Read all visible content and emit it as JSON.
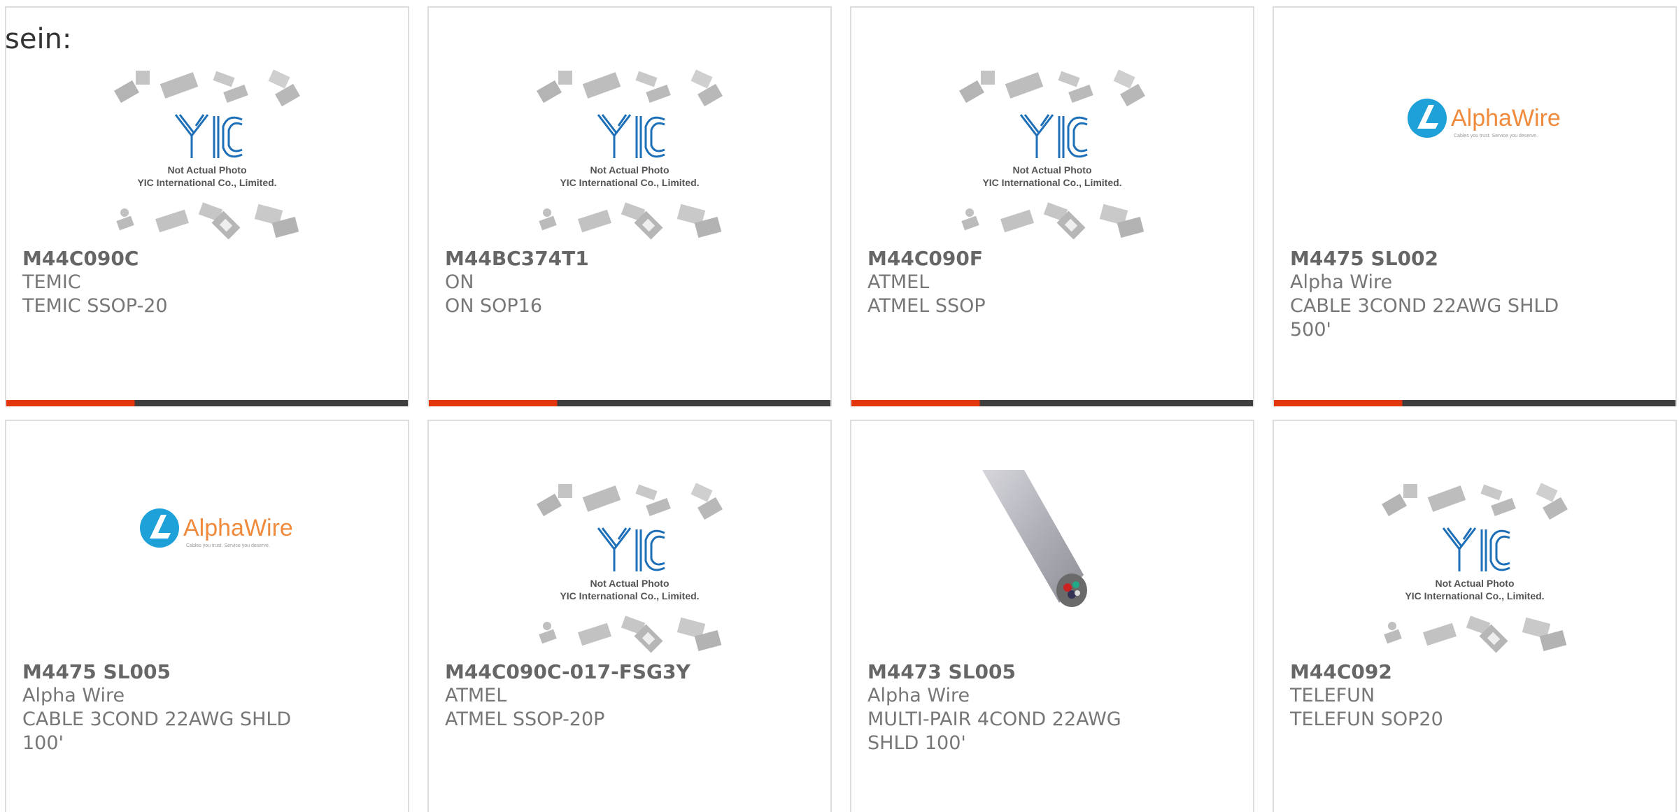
{
  "intro_text": "sein:",
  "products": [
    {
      "part": "M44C090C",
      "manufacturer": "TEMIC",
      "description": "TEMIC SSOP-20",
      "image": "yic-placeholder"
    },
    {
      "part": "M44BC374T1",
      "manufacturer": "ON",
      "description": "ON SOP16",
      "image": "yic-placeholder"
    },
    {
      "part": "M44C090F",
      "manufacturer": "ATMEL",
      "description": "ATMEL SSOP",
      "image": "yic-placeholder"
    },
    {
      "part": "M4475 SL002",
      "manufacturer": "Alpha Wire",
      "description": "CABLE 3COND 22AWG SHLD 500'",
      "image": "alphawire-logo"
    },
    {
      "part": "M4475 SL005",
      "manufacturer": "Alpha Wire",
      "description": "CABLE 3COND 22AWG SHLD 100'",
      "image": "alphawire-logo"
    },
    {
      "part": "M44C090C-017-FSG3Y",
      "manufacturer": "ATMEL",
      "description": "ATMEL SSOP-20P",
      "image": "yic-placeholder"
    },
    {
      "part": "M4473 SL005",
      "manufacturer": "Alpha Wire",
      "description": "MULTI-PAIR 4COND 22AWG SHLD 100'",
      "image": "cable-photo"
    },
    {
      "part": "M44C092",
      "manufacturer": "TELEFUN",
      "description": "TELEFUN SOP20",
      "image": "yic-placeholder"
    }
  ],
  "yic_placeholder": {
    "line1": "Not Actual Photo",
    "line2": "YIC International Co., Limited.",
    "logo": "YIC"
  },
  "alphawire_logo": {
    "brand": "AlphaWire",
    "tagline": "Cables you trust. Service you deserve."
  },
  "colors": {
    "accent_red": "#e3360d",
    "bar_dark": "#3e3e3e",
    "alpha_orange": "#f08a3c",
    "alpha_blue": "#1ea0d8",
    "yic_blue": "#1d6fb8"
  }
}
